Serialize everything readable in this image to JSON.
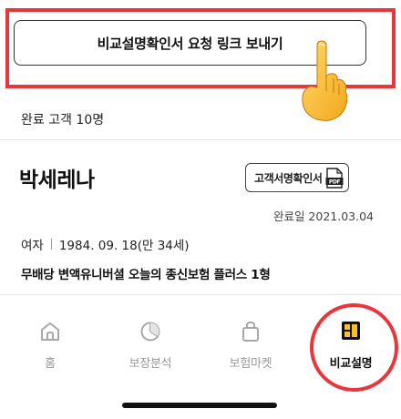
{
  "request": {
    "button_label": "비교설명확인서 요청 링크 보내기"
  },
  "summary": {
    "done_count": "완료 고객 10명"
  },
  "customer": {
    "name": "박세레나",
    "confirm_button_label": "고객서명확인서",
    "complete_date": "완료일 2021.03.04",
    "gender": "여자",
    "birth": "1984. 09. 18(만 34세)",
    "product": "무배당 변액유니버셜 오늘의 종신보험 플러스 1형"
  },
  "tabs": [
    {
      "label": "홈",
      "icon": "home-icon"
    },
    {
      "label": "보장분석",
      "icon": "pie-chart-icon"
    },
    {
      "label": "보험마켓",
      "icon": "shopping-bag-icon"
    },
    {
      "label": "비교설명",
      "icon": "grid-icon",
      "active": true
    }
  ],
  "colors": {
    "highlight": "#e8363c",
    "inactive": "#9a9a9a",
    "active": "#111111"
  }
}
